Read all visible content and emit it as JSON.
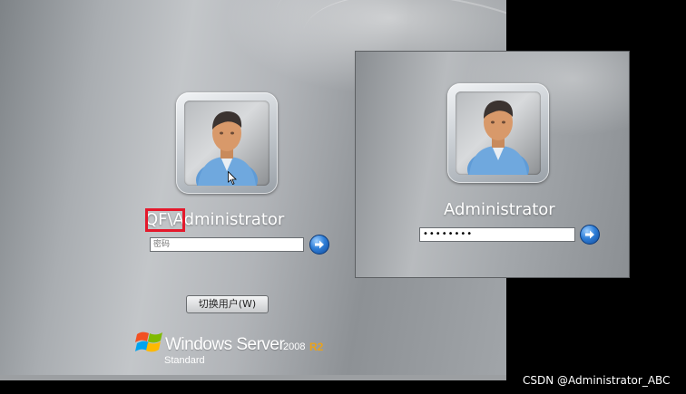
{
  "left_login": {
    "user_name": "QF\\Administrator",
    "password_placeholder": "密码",
    "switch_user_label": "切换用户(W)"
  },
  "right_login": {
    "user_name": "Administrator",
    "password_value": "••••••••"
  },
  "branding": {
    "product_name": "Windows Server",
    "version": "2008",
    "release": "R2",
    "edition": "Standard"
  },
  "watermark": "CSDN @Administrator_ABC",
  "colors": {
    "highlight": "#e4182b",
    "accent_blue": "#2f7fd8",
    "r2_orange": "#e9a21a"
  },
  "icons": [
    "user-avatar-icon",
    "arrow-right-icon",
    "windows-logo-icon",
    "mouse-cursor-icon"
  ]
}
